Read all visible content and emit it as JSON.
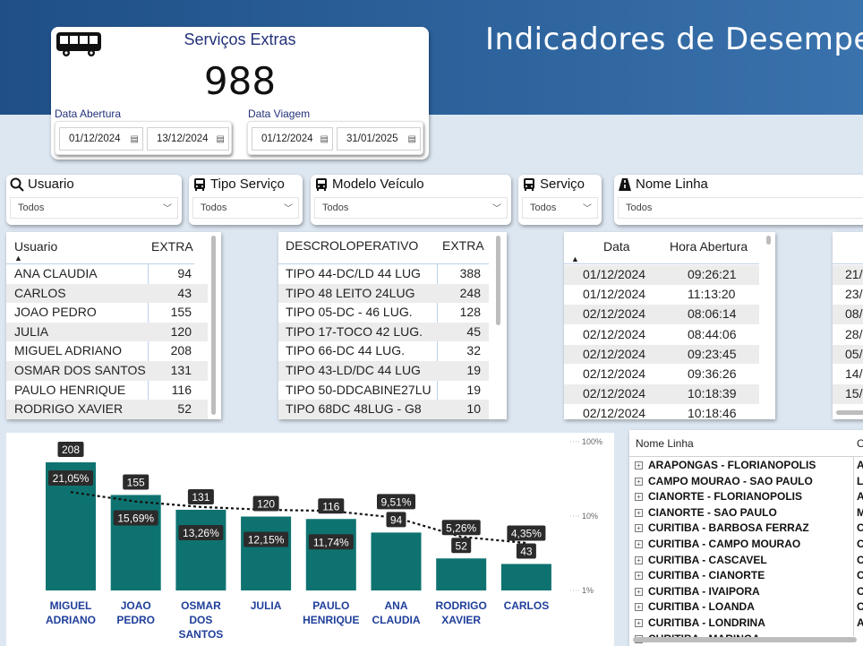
{
  "header": {
    "title": "Indicadores de Desempe"
  },
  "kpi": {
    "label": "Serviços Extras",
    "value": "988",
    "data_abertura": {
      "label": "Data Abertura",
      "from": "01/12/2024",
      "to": "13/12/2024"
    },
    "data_viagem": {
      "label": "Data Viagem",
      "from": "01/12/2024",
      "to": "31/01/2025"
    }
  },
  "slicers": [
    {
      "title": "Usuario",
      "icon": "search-icon",
      "value": "Todos"
    },
    {
      "title": "Tipo Serviço",
      "icon": "bus-icon",
      "value": "Todos"
    },
    {
      "title": "Modelo Veículo",
      "icon": "bus-icon",
      "value": "Todos"
    },
    {
      "title": "Serviço",
      "icon": "bus-icon",
      "value": "Todos"
    },
    {
      "title": "Nome Linha",
      "icon": "road-icon",
      "value": "Todos"
    }
  ],
  "usuario_table": {
    "headers": [
      "Usuario",
      "EXTRA"
    ],
    "rows": [
      [
        "ANA CLAUDIA",
        "94"
      ],
      [
        "CARLOS",
        "43"
      ],
      [
        "JOAO PEDRO",
        "155"
      ],
      [
        "JULIA",
        "120"
      ],
      [
        "MIGUEL ADRIANO",
        "208"
      ],
      [
        "OSMAR DOS SANTOS",
        "131"
      ],
      [
        "PAULO HENRIQUE",
        "116"
      ],
      [
        "RODRIGO XAVIER",
        "52"
      ]
    ]
  },
  "descr_table": {
    "headers": [
      "DESCROLOPERATIVO",
      "EXTRA"
    ],
    "rows": [
      [
        "TIPO 44-DC/LD 44 LUG",
        "388"
      ],
      [
        "TIPO 48 LEITO 24LUG",
        "248"
      ],
      [
        "TIPO 05-DC - 46 LUG.",
        "128"
      ],
      [
        "TIPO 17-TOCO 42 LUG.",
        "45"
      ],
      [
        "TIPO 66-DC 44 LUG.",
        "32"
      ],
      [
        "TIPO 43-LD/DC 44 LUG",
        "19"
      ],
      [
        "TIPO 50-DDCABINE27LU",
        "19"
      ],
      [
        "TIPO 68DC 48LUG - G8",
        "10"
      ]
    ]
  },
  "data_table": {
    "headers": [
      "Data",
      "Hora Abertura"
    ],
    "rows": [
      [
        "01/12/2024",
        "09:26:21"
      ],
      [
        "01/12/2024",
        "11:13:20"
      ],
      [
        "02/12/2024",
        "08:06:14"
      ],
      [
        "02/12/2024",
        "08:44:06"
      ],
      [
        "02/12/2024",
        "09:23:45"
      ],
      [
        "02/12/2024",
        "09:36:26"
      ],
      [
        "02/12/2024",
        "10:18:39"
      ],
      [
        "02/12/2024",
        "10:18:46"
      ]
    ]
  },
  "partial_table": {
    "rows": [
      "21/",
      "23/",
      "08/",
      "28/",
      "05/",
      "14/",
      "15/"
    ]
  },
  "chart_data": {
    "type": "bar",
    "categories": [
      "MIGUEL ADRIANO",
      "JOAO PEDRO",
      "OSMAR DOS SANTOS",
      "JULIA",
      "PAULO HENRIQUE",
      "ANA CLAUDIA",
      "RODRIGO XAVIER",
      "CARLOS"
    ],
    "category_lines": [
      [
        "MIGUEL",
        "ADRIANO"
      ],
      [
        "JOAO",
        "PEDRO"
      ],
      [
        "OSMAR",
        "DOS",
        "SANTOS"
      ],
      [
        "JULIA"
      ],
      [
        "PAULO",
        "HENRIQUE"
      ],
      [
        "ANA",
        "CLAUDIA"
      ],
      [
        "RODRIGO",
        "XAVIER"
      ],
      [
        "CARLOS"
      ]
    ],
    "series": [
      {
        "name": "EXTRA",
        "values": [
          208,
          155,
          131,
          120,
          116,
          94,
          52,
          43
        ]
      },
      {
        "name": "%",
        "values": [
          21.05,
          15.69,
          13.26,
          12.15,
          11.74,
          9.51,
          5.26,
          4.35
        ],
        "labels": [
          "21,05%",
          "15,69%",
          "13,26%",
          "12,15%",
          "11,74%",
          "9,51%",
          "5,26%",
          "4,35%"
        ]
      }
    ],
    "secondary_axis": {
      "scale": "log",
      "ticks": [
        "100%",
        "10%",
        "1%"
      ]
    },
    "bar_color": "#0e7370",
    "label_color": "#1f3f9a"
  },
  "nome_linha": {
    "header": "Nome Linha",
    "header2": "C",
    "rows": [
      [
        "ARAPONGAS - FLORIANOPOLIS",
        "A"
      ],
      [
        "CAMPO MOURAO - SAO PAULO",
        "L"
      ],
      [
        "CIANORTE - FLORIANOPOLIS",
        "A"
      ],
      [
        "CIANORTE - SAO PAULO",
        "M"
      ],
      [
        "CURITIBA - BARBOSA FERRAZ",
        "C"
      ],
      [
        "CURITIBA - CAMPO MOURAO",
        "C"
      ],
      [
        "CURITIBA - CASCAVEL",
        "C"
      ],
      [
        "CURITIBA - CIANORTE",
        "C"
      ],
      [
        "CURITIBA - IVAIPORA",
        "C"
      ],
      [
        "CURITIBA - LOANDA",
        "C"
      ],
      [
        "CURITIBA - LONDRINA",
        "A"
      ],
      [
        "CURITIBA - MARINGA",
        ""
      ]
    ]
  }
}
